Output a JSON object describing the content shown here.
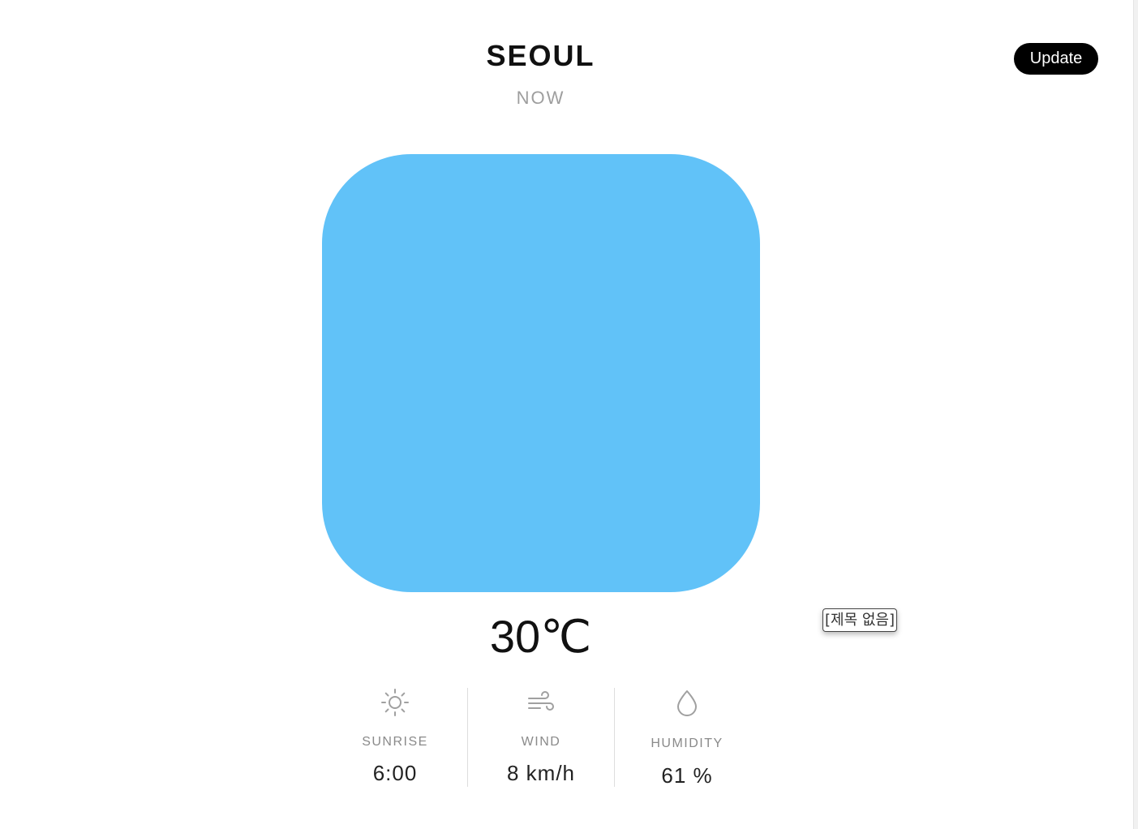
{
  "header": {
    "city": "SEOUL",
    "time_label": "NOW",
    "update_label": "Update"
  },
  "weather": {
    "image_color": "#61c2f8",
    "temperature": "30℃"
  },
  "tooltip": {
    "text": "[제목 없음]"
  },
  "stats": [
    {
      "icon": "sun-icon",
      "label": "SUNRISE",
      "value": "6:00"
    },
    {
      "icon": "wind-icon",
      "label": "WIND",
      "value": "8 km/h"
    },
    {
      "icon": "droplet-icon",
      "label": "HUMIDITY",
      "value": "61 %"
    }
  ],
  "colors": {
    "button_bg": "#000000",
    "muted_text": "#9e9e9e",
    "icon": "#a0a0a0"
  }
}
